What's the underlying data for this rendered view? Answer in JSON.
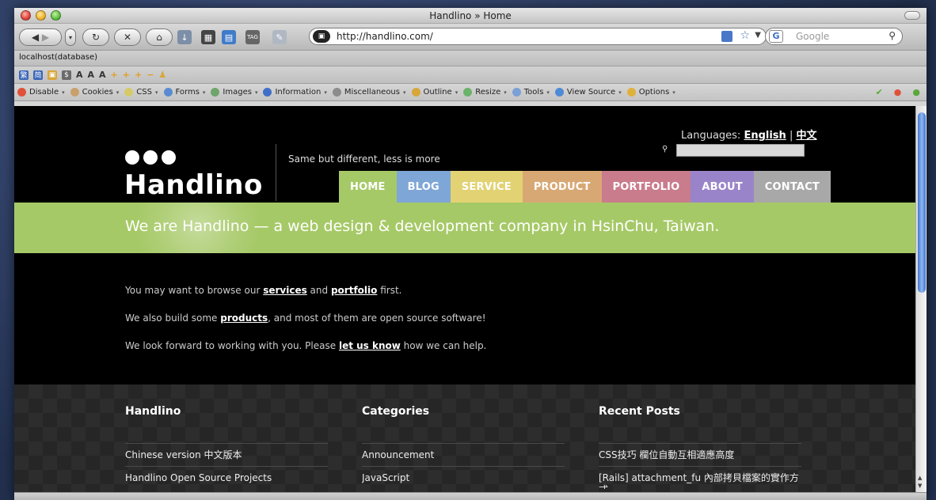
{
  "window": {
    "title": "Handlino » Home"
  },
  "browser": {
    "url": "http://handlino.com/",
    "search_placeholder": "Google",
    "bookmark": "localhost(database)",
    "webdev_items": [
      {
        "label": "Disable",
        "icon": "disable-icon",
        "color": "#e0513a"
      },
      {
        "label": "Cookies",
        "icon": "cookies-icon",
        "color": "#c9a06b"
      },
      {
        "label": "CSS",
        "icon": "css-icon",
        "color": "#d6c96a"
      },
      {
        "label": "Forms",
        "icon": "forms-icon",
        "color": "#5a8bd1"
      },
      {
        "label": "Images",
        "icon": "images-icon",
        "color": "#6fa46b"
      },
      {
        "label": "Information",
        "icon": "information-icon",
        "color": "#3f6fc8"
      },
      {
        "label": "Miscellaneous",
        "icon": "miscellaneous-icon",
        "color": "#8c8c8c"
      },
      {
        "label": "Outline",
        "icon": "outline-icon",
        "color": "#d9a63a"
      },
      {
        "label": "Resize",
        "icon": "resize-icon",
        "color": "#6ab36a"
      },
      {
        "label": "Tools",
        "icon": "tools-icon",
        "color": "#7aa0d6"
      },
      {
        "label": "View Source",
        "icon": "view-source-icon",
        "color": "#4d8bd6"
      },
      {
        "label": "Options",
        "icon": "options-icon",
        "color": "#e0b13a"
      }
    ]
  },
  "site": {
    "logo": "Handlino",
    "tagline": "Same but different, less is more",
    "languages_label": "Languages:",
    "lang_en": "English",
    "lang_sep": "|",
    "lang_zh": "中文",
    "nav": [
      {
        "label": "HOME",
        "color": "#a6c967"
      },
      {
        "label": "BLOG",
        "color": "#7ea6d6"
      },
      {
        "label": "SERVICE",
        "color": "#e2d273"
      },
      {
        "label": "PRODUCT",
        "color": "#d8a874"
      },
      {
        "label": "PORTFOLIO",
        "color": "#c97c8c"
      },
      {
        "label": "ABOUT",
        "color": "#9a84c9"
      },
      {
        "label": "CONTACT",
        "color": "#a8a8a8"
      }
    ],
    "headline": "We are Handlino — a web design & development company in HsinChu, Taiwan.",
    "intro": {
      "line1": {
        "pre": "You may want to browse our ",
        "link1": "services",
        "mid": " and ",
        "link2": "portfolio",
        "post": " first."
      },
      "line2": {
        "pre": "We also build some ",
        "link": "products",
        "post": ", and most of them are open source software!"
      },
      "line3": {
        "pre": "We look forward to working with you. Please ",
        "link": "let us know",
        "post": " how we can help."
      }
    },
    "footer": {
      "col1": {
        "title": "Handlino",
        "items": [
          "Chinese version 中文版本",
          "Handlino Open Source Projects"
        ]
      },
      "col2": {
        "title": "Categories",
        "items": [
          "Announcement",
          "JavaScript"
        ]
      },
      "col3": {
        "title": "Recent Posts",
        "items": [
          "CSS技巧 欄位自動互相適應高度",
          "[Rails] attachment_fu 內部拷貝檔案的實作方式"
        ]
      }
    }
  }
}
